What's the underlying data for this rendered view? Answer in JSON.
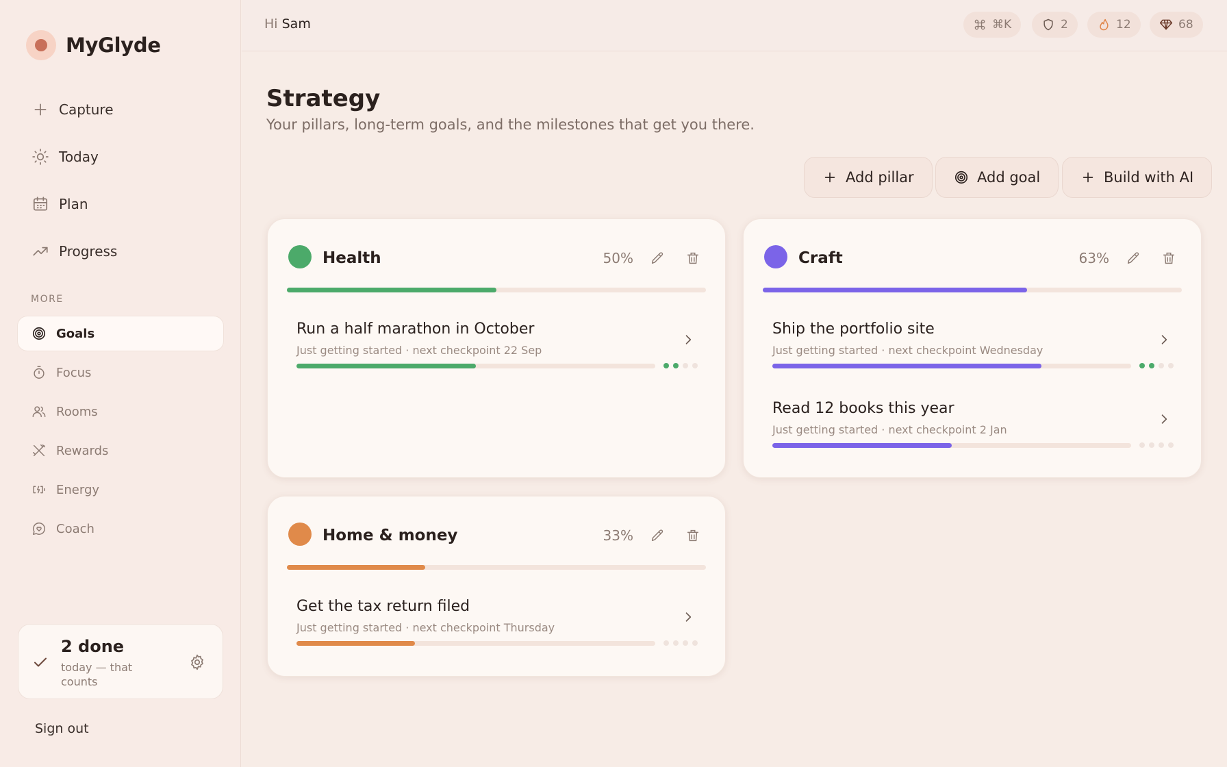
{
  "app": {
    "name": "MyGlyde"
  },
  "nav": {
    "main": [
      {
        "label": "Capture",
        "icon": "plus-icon"
      },
      {
        "label": "Today",
        "icon": "sun-icon"
      },
      {
        "label": "Plan",
        "icon": "calendar-icon"
      },
      {
        "label": "Progress",
        "icon": "trending-up-icon"
      }
    ],
    "more_label": "MORE",
    "more": [
      {
        "label": "Goals",
        "icon": "target-icon",
        "active": true
      },
      {
        "label": "Focus",
        "icon": "timer-icon"
      },
      {
        "label": "Rooms",
        "icon": "users-icon"
      },
      {
        "label": "Rewards",
        "icon": "utensils-icon"
      },
      {
        "label": "Energy",
        "icon": "battery-icon"
      },
      {
        "label": "Coach",
        "icon": "chat-heart-icon"
      }
    ]
  },
  "done_card": {
    "title": "2 done",
    "subtitle": "today — that counts"
  },
  "signout_label": "Sign out",
  "topbar": {
    "greeting_prefix": "Hi",
    "user_name": "Sam",
    "shortcut": "⌘K",
    "shields": "2",
    "streak": "12",
    "gems": "68"
  },
  "page": {
    "title": "Strategy",
    "subtitle": "Your pillars, long-term goals, and the milestones that get you there."
  },
  "actions": {
    "add_pillar": "Add pillar",
    "add_goal": "Add goal",
    "build_ai": "Build with AI"
  },
  "colors": {
    "health": "#4caa6a",
    "craft": "#7b64e8",
    "home": "#e08a4a",
    "brand": "#c8705a"
  },
  "pillars": [
    {
      "name": "Health",
      "percent": "50%",
      "progress": 0.5,
      "goals": [
        {
          "title": "Run a half marathon in October",
          "meta": "Just getting started · next checkpoint 22 Sep",
          "progress": 0.5,
          "checkpoints_done": 2,
          "checkpoints_total": 4
        }
      ]
    },
    {
      "name": "Craft",
      "percent": "63%",
      "progress": 0.63,
      "goals": [
        {
          "title": "Ship the portfolio site",
          "meta": "Just getting started · next checkpoint Wednesday",
          "progress": 0.75,
          "checkpoints_done": 2,
          "checkpoints_total": 4
        },
        {
          "title": "Read 12 books this year",
          "meta": "Just getting started · next checkpoint 2 Jan",
          "progress": 0.5,
          "checkpoints_done": 0,
          "checkpoints_total": 4
        }
      ]
    },
    {
      "name": "Home & money",
      "percent": "33%",
      "progress": 0.33,
      "goals": [
        {
          "title": "Get the tax return filed",
          "meta": "Just getting started · next checkpoint Thursday",
          "progress": 0.33,
          "checkpoints_done": 0,
          "checkpoints_total": 4
        }
      ]
    }
  ]
}
